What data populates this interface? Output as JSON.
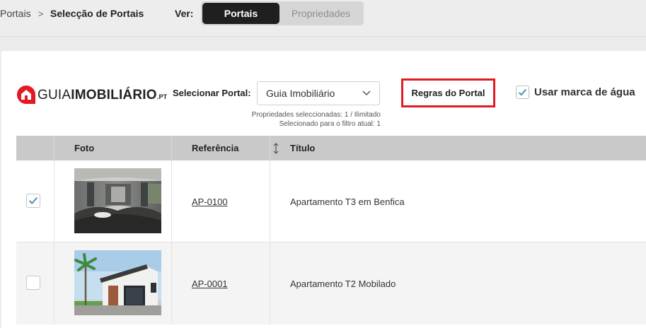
{
  "breadcrumb": {
    "root": "Portais",
    "separator": ">",
    "current": "Selecção de Portais"
  },
  "view": {
    "label": "Ver:",
    "options": [
      "Portais",
      "Propriedades"
    ],
    "selected": "Portais"
  },
  "logo": {
    "part1": "GUIA",
    "part2": "IMOBILIÁRIO",
    "part3": ".PT",
    "brand_color": "#e01b24"
  },
  "portal_select": {
    "label": "Selecionar Portal:",
    "value": "Guia Imobiliário"
  },
  "stats": {
    "selected": "Propriedades seleccionadas: 1 / Ilimitado",
    "filter": "Selecionado para o filtro atual: 1"
  },
  "rules_button": "Regras do Portal",
  "watermark": {
    "label": "Usar marca de água",
    "checked": true
  },
  "table": {
    "columns": [
      "Foto",
      "Referência",
      "Título"
    ],
    "rows": [
      {
        "checked": true,
        "reference": "AP-0100",
        "title": "Apartamento T3 em Benfica"
      },
      {
        "checked": false,
        "reference": "AP-0001",
        "title": "Apartamento T2 Mobilado"
      }
    ]
  },
  "colors": {
    "accent_check": "#4a90b8",
    "highlight_border": "#e01b24",
    "segment_active": "#1f1f1f"
  }
}
